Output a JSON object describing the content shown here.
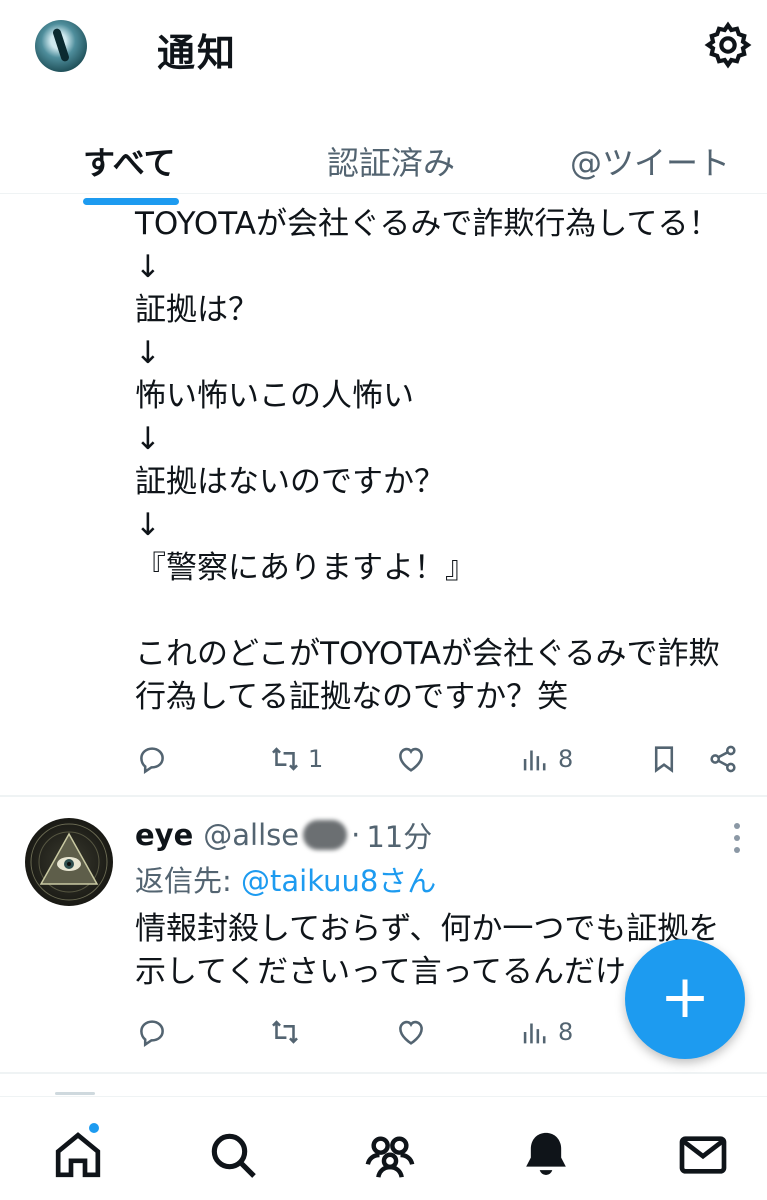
{
  "header": {
    "title": "通知",
    "avatar_icon": "user-avatar",
    "settings_icon": "gear-icon"
  },
  "tabs": [
    {
      "label": "すべて",
      "active": true
    },
    {
      "label": "認証済み",
      "active": false
    },
    {
      "label": "@ツイート",
      "active": false
    }
  ],
  "tweet1": {
    "lines": [
      "TOYOTAが会社ぐるみで詐欺行為してる！",
      "↓",
      "証拠は？",
      "↓",
      "怖い怖いこの人怖い",
      "↓",
      "証拠はないのですか？",
      "↓",
      "『警察にありますよ！』",
      "",
      "これのどこがTOYOTAが会社ぐるみで詐欺",
      "行為してる証拠なのですか？笑"
    ],
    "actions": {
      "reply_count": "",
      "retweet_count": "1",
      "like_count": "",
      "view_count": "8"
    }
  },
  "tweet2": {
    "name": "eye",
    "handle": "@allse",
    "separator": "·",
    "time": "11分",
    "reply_prefix": "返信先: ",
    "reply_to": "@taikuu8さん",
    "lines": [
      "情報封殺しておらず、何か一つでも証拠を",
      "示してくださいって言ってるんだけ"
    ],
    "actions": {
      "reply_count": "",
      "retweet_count": "",
      "like_count": "",
      "view_count": "8"
    }
  },
  "fab": {
    "label": "+"
  },
  "colors": {
    "accent": "#1d9bf0",
    "text": "#0f1419",
    "muted": "#536471",
    "divider": "#eff3f4"
  },
  "bottom_nav": [
    "home-icon",
    "search-icon",
    "communities-icon",
    "notifications-icon",
    "messages-icon"
  ]
}
